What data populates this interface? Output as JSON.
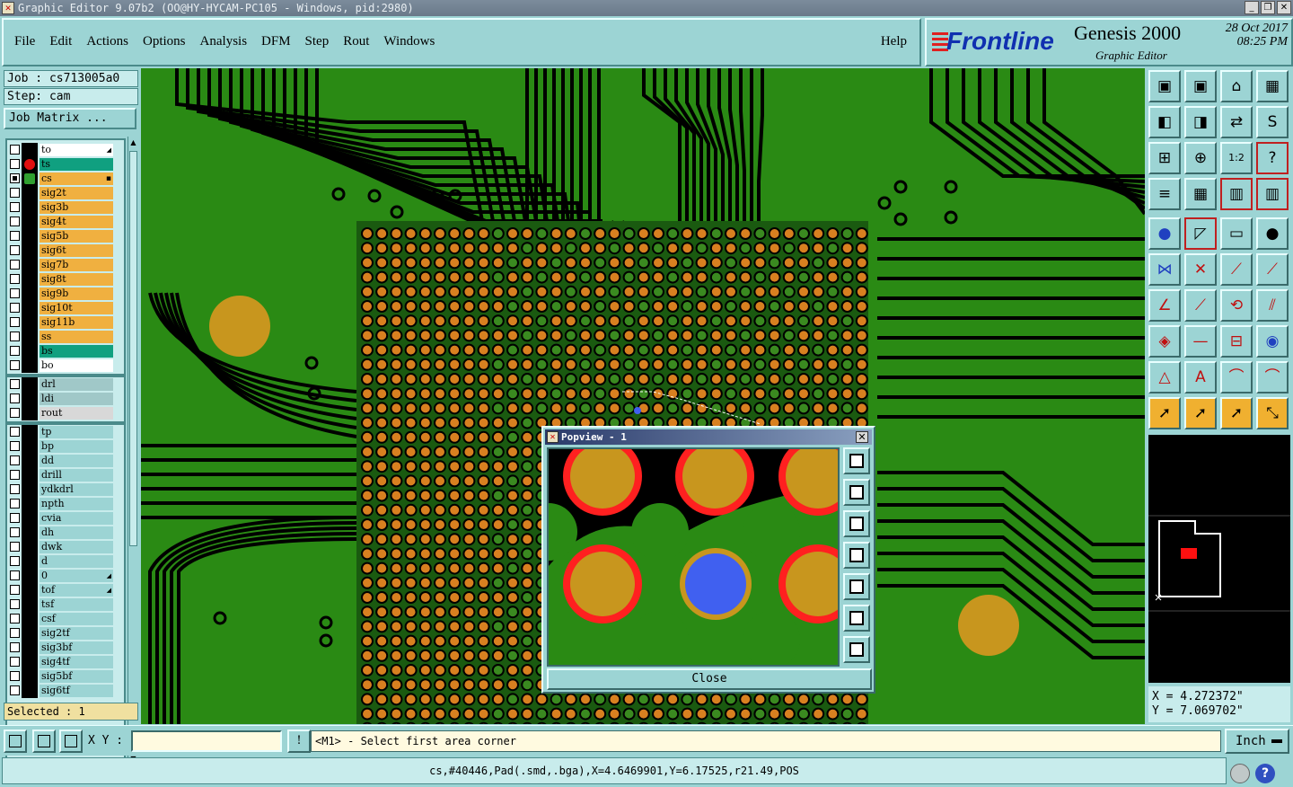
{
  "window": {
    "title": "Graphic Editor 9.07b2 (OO@HY-HYCAM-PC105 - Windows, pid:2980)"
  },
  "menubar": {
    "items": [
      "File",
      "Edit",
      "Actions",
      "Options",
      "Analysis",
      "DFM",
      "Step",
      "Rout",
      "Windows"
    ],
    "help": "Help"
  },
  "logo": {
    "brand": "Frontline",
    "product": "Genesis 2000",
    "subtitle": "Graphic Editor",
    "date": "28 Oct 2017",
    "time": "08:25 PM"
  },
  "left": {
    "job": "Job : cs713005a0",
    "step": "Step: cam",
    "job_matrix": "Job Matrix ...",
    "selected": "Selected : 1"
  },
  "layers": [
    {
      "name": "to",
      "color": "#ffffff",
      "checked": false,
      "mark": "",
      "flag": "arrow"
    },
    {
      "name": "ts",
      "color": "#10a080",
      "checked": false,
      "mark": "red",
      "flag": ""
    },
    {
      "name": "cs",
      "color": "#f0b040",
      "checked": true,
      "mark": "edit",
      "flag": "box"
    },
    {
      "name": "sig2t",
      "color": "#f0b040",
      "checked": false,
      "mark": "",
      "flag": ""
    },
    {
      "name": "sig3b",
      "color": "#f0b040",
      "checked": false,
      "mark": "",
      "flag": ""
    },
    {
      "name": "sig4t",
      "color": "#f0b040",
      "checked": false,
      "mark": "",
      "flag": ""
    },
    {
      "name": "sig5b",
      "color": "#f0b040",
      "checked": false,
      "mark": "",
      "flag": ""
    },
    {
      "name": "sig6t",
      "color": "#f0b040",
      "checked": false,
      "mark": "",
      "flag": ""
    },
    {
      "name": "sig7b",
      "color": "#f0b040",
      "checked": false,
      "mark": "",
      "flag": ""
    },
    {
      "name": "sig8t",
      "color": "#f0b040",
      "checked": false,
      "mark": "",
      "flag": ""
    },
    {
      "name": "sig9b",
      "color": "#f0b040",
      "checked": false,
      "mark": "",
      "flag": ""
    },
    {
      "name": "sig10t",
      "color": "#f0b040",
      "checked": false,
      "mark": "",
      "flag": ""
    },
    {
      "name": "sig11b",
      "color": "#f0b040",
      "checked": false,
      "mark": "",
      "flag": ""
    },
    {
      "name": "ss",
      "color": "#f0b040",
      "checked": false,
      "mark": "",
      "flag": ""
    },
    {
      "name": "bs",
      "color": "#10a080",
      "checked": false,
      "mark": "",
      "flag": ""
    },
    {
      "name": "bo",
      "color": "#ffffff",
      "checked": false,
      "mark": "",
      "flag": ""
    },
    {
      "name": "drl",
      "color": "#a0c8c8",
      "checked": false,
      "mark": "",
      "flag": ""
    },
    {
      "name": "ldi",
      "color": "#a0c8c8",
      "checked": false,
      "mark": "",
      "flag": ""
    },
    {
      "name": "rout",
      "color": "#d8d8d8",
      "checked": false,
      "mark": "",
      "flag": ""
    },
    {
      "name": "tp",
      "color": "#9cd4d4",
      "checked": false,
      "mark": "",
      "flag": ""
    },
    {
      "name": "bp",
      "color": "#9cd4d4",
      "checked": false,
      "mark": "",
      "flag": ""
    },
    {
      "name": "dd",
      "color": "#9cd4d4",
      "checked": false,
      "mark": "",
      "flag": ""
    },
    {
      "name": "drill",
      "color": "#9cd4d4",
      "checked": false,
      "mark": "",
      "flag": ""
    },
    {
      "name": "ydkdrl",
      "color": "#9cd4d4",
      "checked": false,
      "mark": "",
      "flag": ""
    },
    {
      "name": "npth",
      "color": "#9cd4d4",
      "checked": false,
      "mark": "",
      "flag": ""
    },
    {
      "name": "cvia",
      "color": "#9cd4d4",
      "checked": false,
      "mark": "",
      "flag": ""
    },
    {
      "name": "dh",
      "color": "#9cd4d4",
      "checked": false,
      "mark": "",
      "flag": ""
    },
    {
      "name": "dwk",
      "color": "#9cd4d4",
      "checked": false,
      "mark": "",
      "flag": ""
    },
    {
      "name": "d",
      "color": "#9cd4d4",
      "checked": false,
      "mark": "",
      "flag": ""
    },
    {
      "name": "0",
      "color": "#9cd4d4",
      "checked": false,
      "mark": "",
      "flag": "arrow"
    },
    {
      "name": "tof",
      "color": "#9cd4d4",
      "checked": false,
      "mark": "",
      "flag": "arrow"
    },
    {
      "name": "tsf",
      "color": "#9cd4d4",
      "checked": false,
      "mark": "",
      "flag": ""
    },
    {
      "name": "csf",
      "color": "#9cd4d4",
      "checked": false,
      "mark": "",
      "flag": ""
    },
    {
      "name": "sig2tf",
      "color": "#9cd4d4",
      "checked": false,
      "mark": "",
      "flag": ""
    },
    {
      "name": "sig3bf",
      "color": "#9cd4d4",
      "checked": false,
      "mark": "",
      "flag": ""
    },
    {
      "name": "sig4tf",
      "color": "#9cd4d4",
      "checked": false,
      "mark": "",
      "flag": ""
    },
    {
      "name": "sig5bf",
      "color": "#9cd4d4",
      "checked": false,
      "mark": "",
      "flag": ""
    },
    {
      "name": "sig6tf",
      "color": "#9cd4d4",
      "checked": false,
      "mark": "",
      "flag": ""
    }
  ],
  "popview": {
    "title": "Popview - 1",
    "close_label": "Close"
  },
  "toolbox": {
    "icons": [
      "zoom-home-icon",
      "zoom-back-icon",
      "home-icon",
      "window-icon",
      "pan-left-icon",
      "pan-right-icon",
      "swap-icon",
      "snap-icon",
      "zoom-fit-icon",
      "zoom-center-icon",
      "scale-1-2-icon",
      "help-icon",
      "grid-config-icon",
      "grid-icon",
      "layer-stack-icon",
      "layer-compare-icon",
      "add-pad-icon",
      "corner-icon",
      "measure-icon",
      "pad-icon",
      "connect-icon",
      "cross-icon",
      "line-icon",
      "line-add-icon",
      "angle-icon",
      "slash-icon",
      "arc-icon",
      "text-icon",
      "node-icon",
      "minus-icon",
      "dimension-icon",
      "group-icon",
      "triangle-icon",
      "a-shape-icon",
      "arch-icon",
      "measure-arch-icon",
      "select-arrow-icon",
      "select-box-icon",
      "select-cursor-icon",
      "route-icon"
    ]
  },
  "coords": {
    "x": "X = 4.272372\"",
    "y": "Y = 7.069702\""
  },
  "bottom": {
    "xy_label": "X Y :",
    "message": "<M1> - Select first area corner",
    "unit": "Inch",
    "status": "cs,#40446,Pad(.smd,.bga),X=4.6469901,Y=6.17525,r21.49,POS"
  },
  "colors": {
    "board_green": "#2a8a14",
    "trace_black": "#000000",
    "pad_gold": "#c8961e",
    "pad_orange": "#d88020",
    "highlight_red": "#ff2020",
    "selected_blue": "#4060f0",
    "panel_cyan": "#9cd4d4"
  }
}
